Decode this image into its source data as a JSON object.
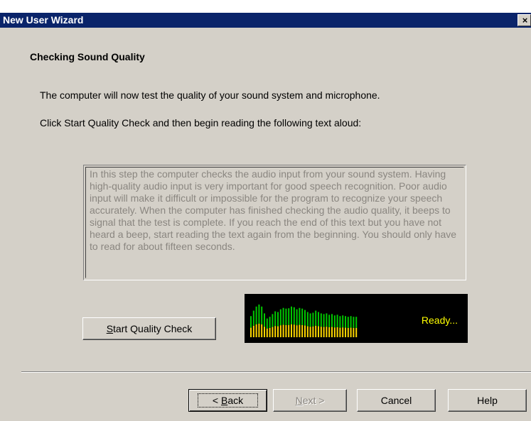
{
  "window": {
    "title": "New User Wizard",
    "close_glyph": "×"
  },
  "page": {
    "heading": "Checking Sound Quality",
    "intro": "The computer will now test the quality of your sound system and microphone.",
    "instruction": "Click Start Quality Check and then begin reading the following text aloud:",
    "reading_text": "In this step the computer checks the audio input from your sound system. Having high-quality audio input is very important for good speech recognition. Poor audio input will make it difficult or impossible for the program to recognize your speech accurately. When the computer has finished checking the audio quality, it beeps to signal that the test is complete. If you reach the end of this text but you have not heard a beep, start reading the text again from the beginning. You should only have to read for about fifteen seconds."
  },
  "quality_button": {
    "accel": "S",
    "rest": "tart Quality Check"
  },
  "meter": {
    "status": "Ready...",
    "colors": {
      "background": "#000000",
      "green": "#00c800",
      "yellow": "#ffd800",
      "status": "#ffff00"
    },
    "levels": [
      0.62,
      0.78,
      0.9,
      0.96,
      0.9,
      0.7,
      0.55,
      0.6,
      0.68,
      0.76,
      0.74,
      0.82,
      0.86,
      0.84,
      0.85,
      0.9,
      0.88,
      0.82,
      0.86,
      0.84,
      0.8,
      0.74,
      0.7,
      0.72,
      0.78,
      0.74,
      0.7,
      0.68,
      0.7,
      0.66,
      0.68,
      0.64,
      0.66,
      0.62,
      0.64,
      0.62,
      0.6,
      0.62,
      0.6,
      0.6
    ]
  },
  "nav": {
    "back": {
      "arrow": "< ",
      "accel": "B",
      "rest": "ack"
    },
    "next": {
      "accel": "N",
      "rest": "ext >"
    },
    "cancel": "Cancel",
    "help": "Help"
  }
}
